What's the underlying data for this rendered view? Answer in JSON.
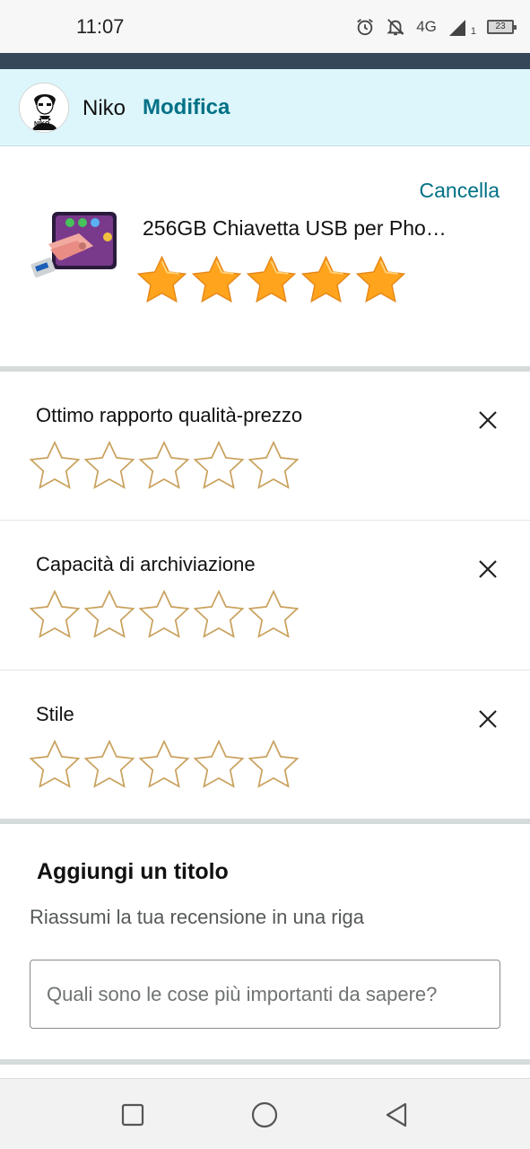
{
  "status_bar": {
    "time": "11:07",
    "network": "4G",
    "signal_sub": "1",
    "battery": "23",
    "icons": [
      "alarm-icon",
      "notifications-off-icon",
      "signal-icon",
      "battery-icon"
    ]
  },
  "profile": {
    "name": "Niko",
    "edit_label": "Modifica",
    "avatar_caption": "NIKO"
  },
  "product": {
    "cancel_label": "Cancella",
    "title": "256GB Chiavetta USB per Pho…",
    "overall_rating": 5,
    "max_rating": 5
  },
  "attributes": [
    {
      "label": "Ottimo rapporto qualità-prezzo",
      "rating": 0
    },
    {
      "label": "Capacità di archiviazione",
      "rating": 0
    },
    {
      "label": "Stile",
      "rating": 0
    }
  ],
  "title_section": {
    "heading": "Aggiungi un titolo",
    "subheading": "Riassumi la tua recensione in una riga",
    "input_placeholder": "Quali sono le cose più importanti da sapere?",
    "input_value": ""
  },
  "nav": {
    "buttons": [
      "recents-square-icon",
      "home-circle-icon",
      "back-triangle-icon"
    ]
  },
  "colors": {
    "accent_link": "#007185",
    "star_filled": "#ffa41c",
    "star_empty_outline": "#c9a25e",
    "profile_bg": "#ddf6fb",
    "header_band": "#37475a"
  }
}
